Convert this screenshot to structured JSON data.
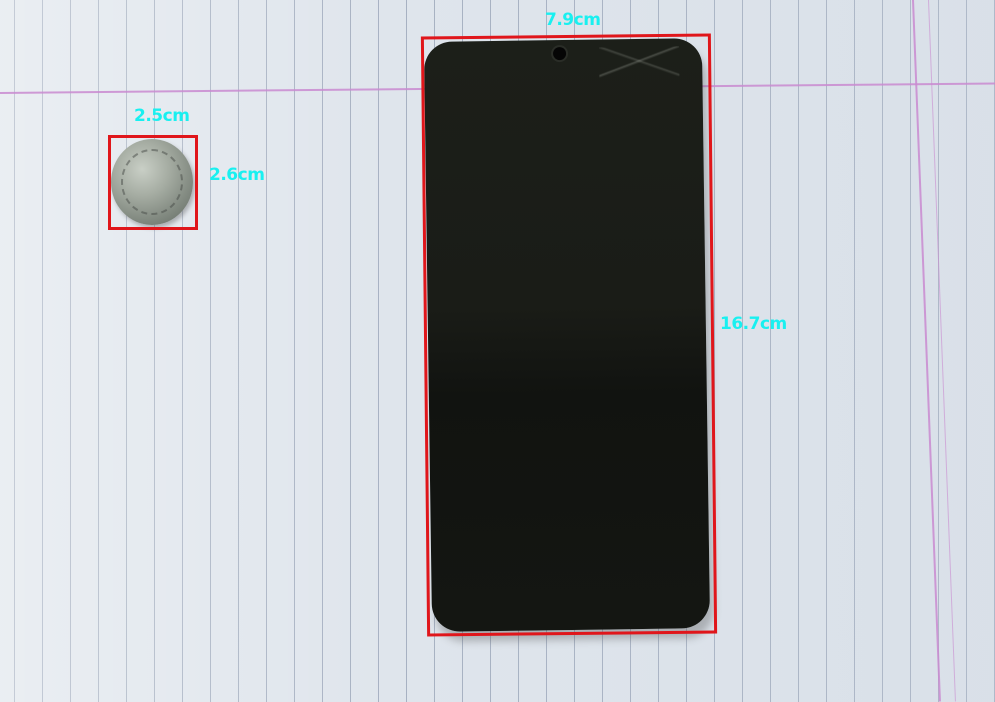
{
  "measurements": {
    "coin_width": "2.5cm",
    "coin_height": "2.6cm",
    "phone_width": "7.9cm",
    "phone_height": "16.7cm"
  },
  "colors": {
    "label": "#19f0f0",
    "bounding_box": "#e0161b",
    "paper": "#dfe5ec",
    "margin_line": "#c98ad0"
  }
}
